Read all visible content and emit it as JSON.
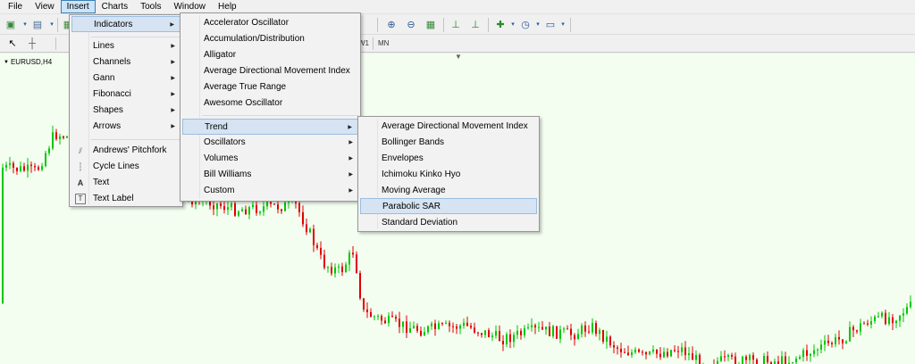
{
  "menubar": {
    "items": [
      "File",
      "View",
      "Insert",
      "Charts",
      "Tools",
      "Window",
      "Help"
    ]
  },
  "toolbar": {
    "timeframes": [
      "W1",
      "MN"
    ]
  },
  "chart": {
    "symbol_label": "EURUSD,H4",
    "colors": {
      "background": "#f3fdf0",
      "bull": "#00c800",
      "bear": "#e00000"
    }
  },
  "insert_menu": {
    "items": [
      {
        "label": "Indicators",
        "submenu": true,
        "highlight": true
      },
      {
        "label": "Lines",
        "submenu": true
      },
      {
        "label": "Channels",
        "submenu": true
      },
      {
        "label": "Gann",
        "submenu": true
      },
      {
        "label": "Fibonacci",
        "submenu": true
      },
      {
        "label": "Shapes",
        "submenu": true
      },
      {
        "label": "Arrows",
        "submenu": true
      },
      {
        "label": "Andrews' Pitchfork",
        "icon": "pitchfork-icon"
      },
      {
        "label": "Cycle Lines",
        "icon": "cycle-lines-icon"
      },
      {
        "label": "Text",
        "icon": "text-icon"
      },
      {
        "label": "Text Label",
        "icon": "text-label-icon"
      }
    ]
  },
  "indicators_menu": {
    "items": [
      {
        "label": "Accelerator Oscillator"
      },
      {
        "label": "Accumulation/Distribution"
      },
      {
        "label": "Alligator"
      },
      {
        "label": "Average Directional Movement Index"
      },
      {
        "label": "Average True Range"
      },
      {
        "label": "Awesome Oscillator"
      },
      {
        "label": "Trend",
        "submenu": true,
        "highlight": true
      },
      {
        "label": "Oscillators",
        "submenu": true
      },
      {
        "label": "Volumes",
        "submenu": true
      },
      {
        "label": "Bill Williams",
        "submenu": true
      },
      {
        "label": "Custom",
        "submenu": true
      }
    ]
  },
  "trend_menu": {
    "items": [
      {
        "label": "Average Directional Movement Index"
      },
      {
        "label": "Bollinger Bands"
      },
      {
        "label": "Envelopes"
      },
      {
        "label": "Ichimoku Kinko Hyo"
      },
      {
        "label": "Moving Average"
      },
      {
        "label": "Parabolic SAR",
        "highlight": true
      },
      {
        "label": "Standard Deviation"
      }
    ]
  }
}
